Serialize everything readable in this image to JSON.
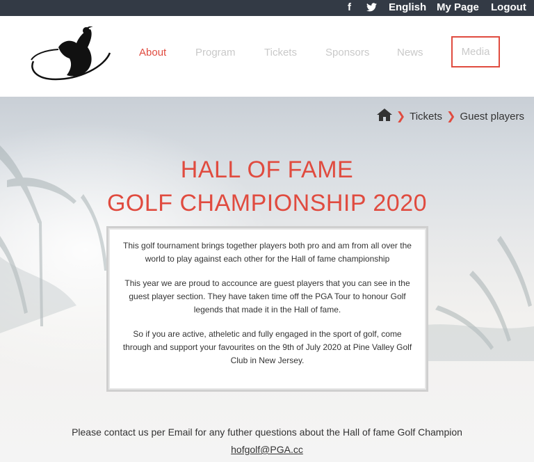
{
  "topbar": {
    "facebook": "f",
    "twitter": "🐦",
    "language": "English",
    "my_page": "My Page",
    "logout": "Logout"
  },
  "nav": {
    "about": "About",
    "program": "Program",
    "tickets": "Tickets",
    "sponsors": "Sponsors",
    "news": "News",
    "media": "Media"
  },
  "breadcrumb": {
    "home_icon": "home-icon",
    "tickets": "Tickets",
    "current": "Guest players"
  },
  "hero": {
    "title_line1": "HALL OF FAME",
    "title_line2": "GOLF CHAMPIONSHIP 2020"
  },
  "card": {
    "p1": "This golf tournament brings together players both pro and am from all over the world to play against each other for the Hall of fame championship",
    "p2": "This year we are proud to accounce are guest players that you can see in the guest player section. They have taken time off the PGA Tour to honour Golf legends that made it in the Hall of fame.",
    "p3": "So if you are active, atheletic and fully engaged in the sport of golf, come through and support your favourites on the 9th of July 2020 at Pine Valley Golf Club in New Jersey."
  },
  "contact": {
    "text": "Please contact us per Email for any futher questions about the Hall of fame Golf Champion",
    "email": "hofgolf@PGA.cc"
  },
  "colors": {
    "accent": "#e04b3f",
    "topbar": "#333a45",
    "nav_inactive": "#c9c9c9"
  }
}
